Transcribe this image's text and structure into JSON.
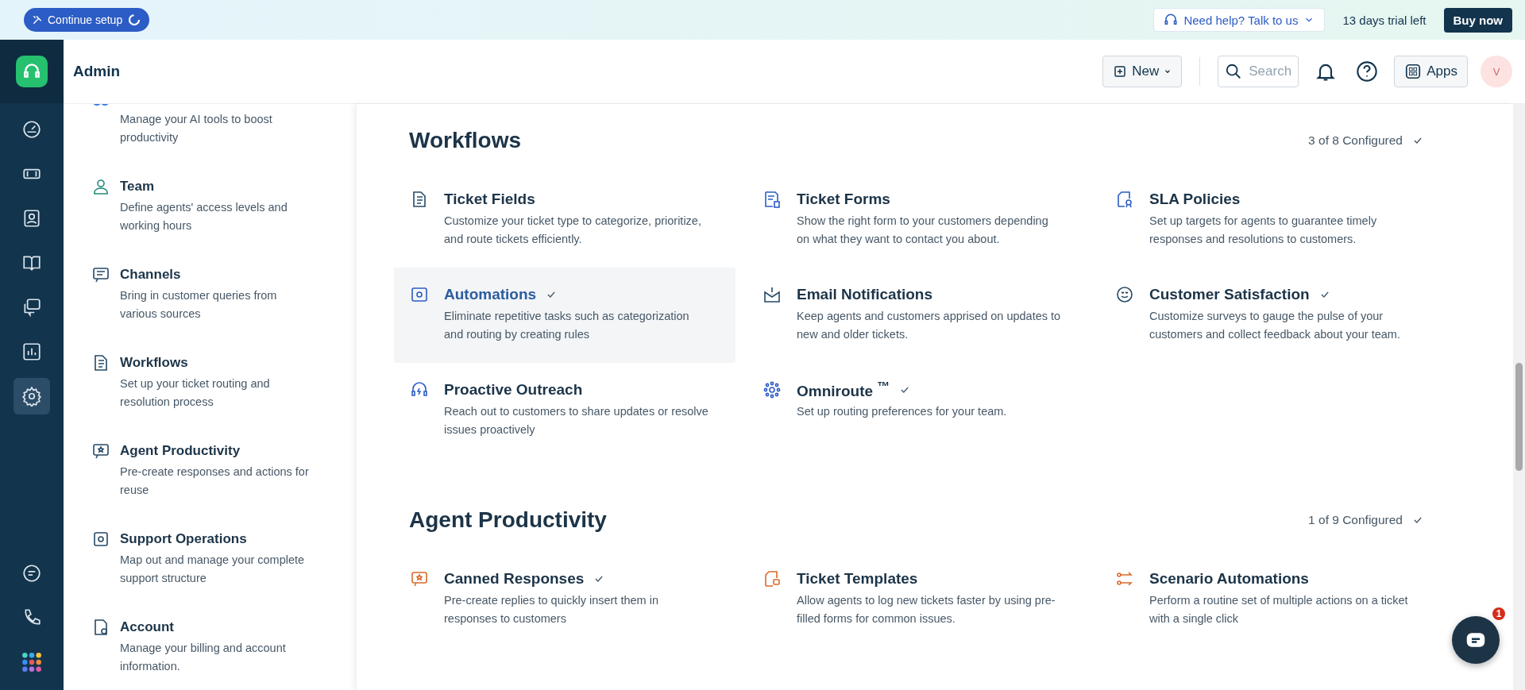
{
  "banner": {
    "setup_button": "Continue setup",
    "help_button": "Need help? Talk to us",
    "trial_text": "13 days trial left",
    "buy_button": "Buy now"
  },
  "header": {
    "title": "Admin",
    "new_button": "New",
    "search": {
      "placeholder": "Search"
    },
    "apps_button": "Apps",
    "avatar": "V"
  },
  "rail": [
    {
      "kind": "dashboard",
      "selected": false
    },
    {
      "kind": "tickets",
      "selected": false
    },
    {
      "kind": "contacts",
      "selected": false
    },
    {
      "kind": "book",
      "selected": false
    },
    {
      "kind": "chat",
      "selected": false
    },
    {
      "kind": "reports",
      "selected": false
    },
    {
      "kind": "settings",
      "selected": true
    },
    {
      "kind": "message",
      "selected": false
    },
    {
      "kind": "phone",
      "selected": false
    },
    {
      "kind": "apps",
      "selected": false
    }
  ],
  "sidebar": {
    "items": [
      {
        "kind": "freddy",
        "description": "Manage your AI tools to boost productivity"
      },
      {
        "kind": "team",
        "title": "Team",
        "description": "Define agents' access levels and working hours"
      },
      {
        "kind": "channels",
        "title": "Channels",
        "description": "Bring in customer queries from various sources"
      },
      {
        "kind": "workflows",
        "title": "Workflows",
        "description": "Set up your ticket routing and resolution process"
      },
      {
        "kind": "productivity",
        "title": "Agent Productivity",
        "description": "Pre-create responses and actions for reuse"
      },
      {
        "kind": "operations",
        "title": "Support Operations",
        "description": "Map out and manage your complete support structure"
      },
      {
        "kind": "account",
        "title": "Account",
        "description": "Manage your billing and account information."
      }
    ]
  },
  "sections": [
    {
      "title": "Workflows",
      "configured": "3 of 8 Configured",
      "cards": [
        {
          "kind": "fields",
          "title": "Ticket Fields",
          "description": "Customize your ticket type to categorize, prioritize, and route tickets efficiently.",
          "configured": false,
          "selected": false
        },
        {
          "kind": "forms",
          "title": "Ticket Forms",
          "description": "Show the right form to your customers depending on what they want to contact you about.",
          "configured": false,
          "selected": false
        },
        {
          "kind": "sla",
          "title": "SLA Policies",
          "description": "Set up targets for agents to guarantee timely responses and resolutions to customers.",
          "configured": false,
          "selected": false
        },
        {
          "kind": "automations",
          "title": "Automations",
          "description": "Eliminate repetitive tasks such as categorization and routing by creating rules",
          "configured": true,
          "selected": true
        },
        {
          "kind": "email",
          "title": "Email Notifications",
          "description": "Keep agents and customers apprised on updates to new and older tickets.",
          "configured": false,
          "selected": false
        },
        {
          "kind": "csat",
          "title": "Customer Satisfaction",
          "description": "Customize surveys to gauge the pulse of your customers and collect feedback about your team.",
          "configured": true,
          "selected": false
        },
        {
          "kind": "outreach",
          "title": "Proactive Outreach",
          "description": "Reach out to customers to share updates or resolve issues proactively",
          "configured": false,
          "selected": false
        },
        {
          "kind": "omniroute",
          "title": "Omniroute $^{™}$",
          "description": "Set up routing preferences for your team.",
          "configured": true,
          "selected": false
        }
      ]
    },
    {
      "title": "Agent Productivity",
      "configured": "1 of 9 Configured",
      "cards": [
        {
          "kind": "canned",
          "title": "Canned Responses",
          "description": "Pre-create replies to quickly insert them in responses to customers",
          "configured": true,
          "selected": false
        },
        {
          "kind": "templates",
          "title": "Ticket Templates",
          "description": "Allow agents to log new tickets faster by using pre-filled forms for common issues.",
          "configured": false,
          "selected": false
        },
        {
          "kind": "scenario",
          "title": "Scenario Automations",
          "description": "Perform a routine set of multiple actions on a ticket with a single click",
          "configured": false,
          "selected": false
        }
      ]
    }
  ],
  "chat_widget": {
    "badge": "1"
  }
}
